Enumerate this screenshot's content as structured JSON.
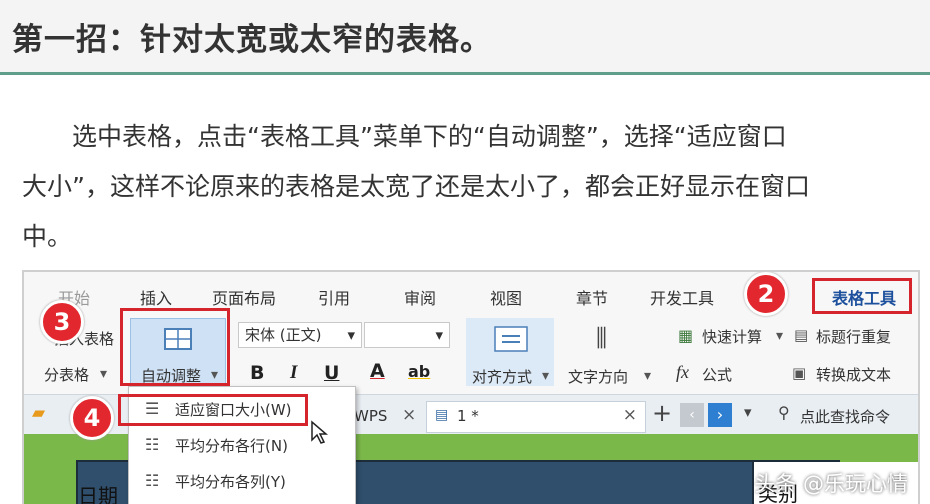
{
  "heading": {
    "title": "第一招：针对太宽或太窄的表格。"
  },
  "paragraph": {
    "lines": [
      "选中表格，点击“表格工具”菜单下的“自动调整”，选择“适应窗口",
      "大小”，这样不论原来的表格是太宽了还是太小了，都会正好显示在窗口",
      "中。"
    ]
  },
  "menu": {
    "items": [
      "开始",
      "插入",
      "页面布局",
      "引用",
      "审阅",
      "视图",
      "章节",
      "开发工具",
      "表格工具"
    ]
  },
  "ribbon": {
    "left_top": "插入表格",
    "left_bottom": "分表格",
    "auto_adjust": "自动调整",
    "font_name": "宋体 (正文)",
    "font_size": "",
    "bold": "B",
    "italic": "I",
    "underline": "U",
    "font_color": "A",
    "highlight": "ab",
    "align": "对齐方式",
    "text_dir": "文字方向",
    "quick_calc": "快速计算",
    "formula": "公式",
    "title_repeat": "标题行重复",
    "to_text": "转换成文本"
  },
  "tabbar": {
    "wps": "WPS",
    "doc": "1 *",
    "search": "点此查找命令"
  },
  "dropdown": {
    "items": [
      {
        "label": "适应窗口大小(W)",
        "icon": "fit-window-icon"
      },
      {
        "label": "平均分布各行(N)",
        "icon": "distribute-rows-icon"
      },
      {
        "label": "平均分布各列(Y)",
        "icon": "distribute-cols-icon"
      }
    ]
  },
  "doc": {
    "cell_left": "日期",
    "cell_right": "类别"
  },
  "badges": {
    "b2": "2",
    "b3": "3",
    "b4": "4"
  },
  "watermark": "头条 @乐玩心情",
  "colors": {
    "accent_rule": "#5f9e8a",
    "highlight_red": "#d6242c",
    "doc_green": "#7bb84a"
  }
}
